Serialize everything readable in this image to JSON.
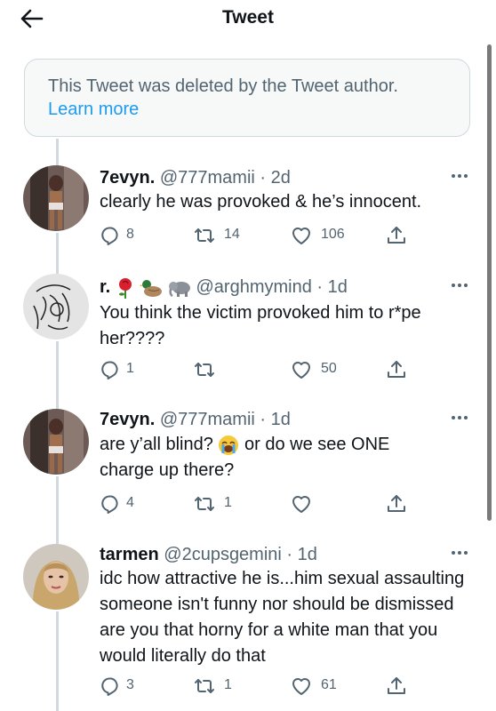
{
  "header": {
    "title": "Tweet"
  },
  "deleted_notice": {
    "text": "This Tweet was deleted by the Tweet author.",
    "link": "Learn more"
  },
  "tweets": [
    {
      "name": "7evyn.",
      "handle": "@777mamii",
      "time": "· 2d",
      "text": "clearly he was provoked & he’s innocent.",
      "replies": "8",
      "retweets": "14",
      "likes": "106"
    },
    {
      "name": "r.",
      "handle": "@arghmymind",
      "time": "· 1d",
      "text": "You think the victim provoked him to r*pe her????",
      "replies": "1",
      "retweets": "",
      "likes": "50"
    },
    {
      "name": "7evyn.",
      "handle": "@777mamii",
      "time": "· 1d",
      "text_before_emoji": "are y’all blind?",
      "text_after_emoji": "or do we see ONE charge up there?",
      "replies": "4",
      "retweets": "1",
      "likes": ""
    },
    {
      "name": "tarmen",
      "handle": "@2cupsgemini",
      "time": "· 1d",
      "text": "idc how attractive he is...him sexual assaulting someone isn't funny nor should be dismissed are you that horny for a white man that you would literally do that",
      "replies": "3",
      "retweets": "1",
      "likes": "61"
    }
  ],
  "icons": {
    "back": "arrow-left-icon",
    "more": "more-dots-icon",
    "reply": "reply-icon",
    "retweet": "retweet-icon",
    "like": "heart-icon",
    "share": "share-icon"
  },
  "colors": {
    "accent": "#1d9bf0",
    "muted": "#536471",
    "text": "#0f1419",
    "border": "#cfd9de"
  }
}
